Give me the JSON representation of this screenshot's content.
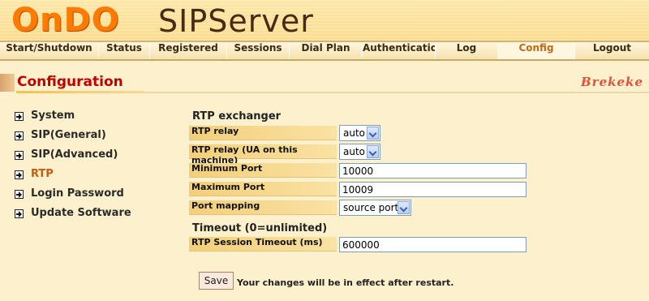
{
  "header": {
    "logo_brand": "OnDO",
    "logo_product": "SIPServer"
  },
  "nav": {
    "items": [
      {
        "label": "Start/Shutdown"
      },
      {
        "label": "Status"
      },
      {
        "label": "Registered"
      },
      {
        "label": "Sessions"
      },
      {
        "label": "Dial Plan"
      },
      {
        "label": "Authentication"
      },
      {
        "label": "Log"
      },
      {
        "label": "Config"
      },
      {
        "label": "Logout"
      }
    ],
    "active": "Config"
  },
  "page": {
    "title": "Configuration",
    "brand": "Brekeke"
  },
  "sidebar": {
    "items": [
      {
        "label": "System",
        "icon": "arrow-box-icon"
      },
      {
        "label": "SIP(General)",
        "icon": "arrow-box-icon"
      },
      {
        "label": "SIP(Advanced)",
        "icon": "arrow-box-icon"
      },
      {
        "label": "RTP",
        "icon": "arrow-box-icon"
      },
      {
        "label": "Login Password",
        "icon": "arrow-box-icon"
      },
      {
        "label": "Update Software",
        "icon": "arrow-box-icon"
      }
    ],
    "active": "RTP"
  },
  "form": {
    "rtp_exchanger": {
      "section_title": "RTP exchanger",
      "rtp_relay": {
        "label": "RTP relay",
        "value": "auto"
      },
      "rtp_relay_ua": {
        "label": "RTP relay (UA on this machine)",
        "value": "auto"
      },
      "min_port": {
        "label": "Minimum Port",
        "value": "10000"
      },
      "max_port": {
        "label": "Maximum Port",
        "value": "10009"
      },
      "port_mapping": {
        "label": "Port mapping",
        "value": "source port"
      }
    },
    "timeout": {
      "section_title": "Timeout (0=unlimited)",
      "rtp_session_timeout": {
        "label": "RTP Session Timeout (ms)",
        "value": "600000"
      }
    },
    "save_label": "Save",
    "save_note": "Your changes will be in effect after restart."
  },
  "colors": {
    "background": "#fdf0cc",
    "title_red": "#c00000",
    "logo_orange": "#ff7a00",
    "active_nav": "#c0681a"
  }
}
